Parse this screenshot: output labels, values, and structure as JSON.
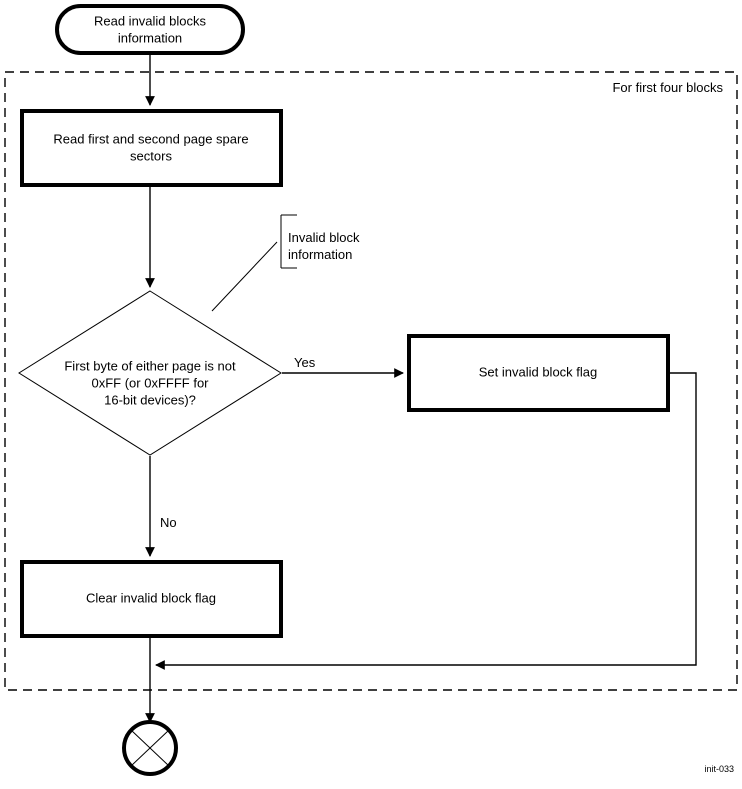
{
  "figure": {
    "caption": "init-033",
    "group_label": "For first four blocks"
  },
  "nodes": {
    "start": {
      "type": "terminator",
      "line1": "Read invalid blocks",
      "line2": "information"
    },
    "read_spare": {
      "type": "process",
      "line1": "Read first and second page spare",
      "line2": "sectors"
    },
    "decision": {
      "type": "decision",
      "line1": "First byte of either page is not",
      "line2": "0xFF (or 0xFFFF for",
      "line3": "16-bit devices)?"
    },
    "set_flag": {
      "type": "process",
      "line1": "Set invalid block flag"
    },
    "clear_flag": {
      "type": "process",
      "line1": "Clear invalid block flag"
    },
    "end": {
      "type": "terminator-circle-x",
      "label": ""
    }
  },
  "edges": {
    "yes_label": "Yes",
    "no_label": "No"
  },
  "annotation": {
    "line1": "Invalid block",
    "line2": "information"
  },
  "colors": {
    "stroke": "#000000",
    "fill": "#ffffff",
    "background": "#ffffff"
  }
}
